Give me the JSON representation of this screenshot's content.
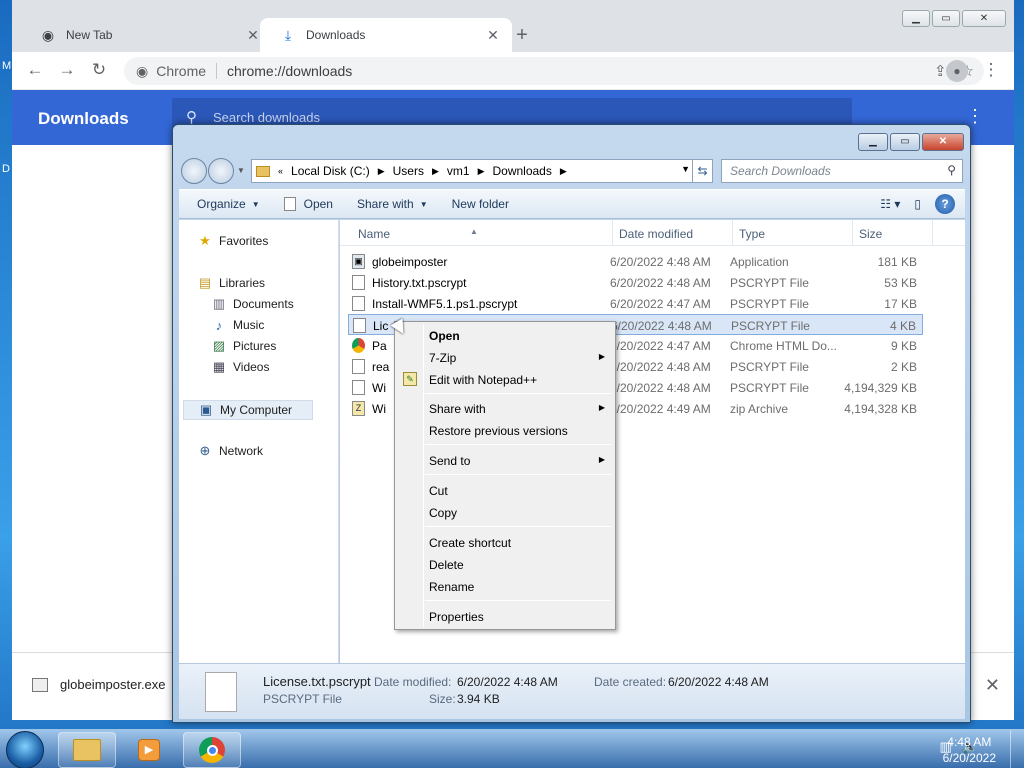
{
  "desktop": {
    "frag1": "M",
    "frag2": "D"
  },
  "chrome": {
    "tabs": [
      {
        "label": "New Tab",
        "icon": "chrome-icon"
      },
      {
        "label": "Downloads",
        "icon": "download-icon"
      }
    ],
    "new_tab_symbol": "+",
    "omnibox": {
      "label": "Chrome",
      "url": "chrome://downloads"
    },
    "downloads_page": {
      "title": "Downloads",
      "search_placeholder": "Search downloads",
      "shelf_item": "globeimposter.exe"
    }
  },
  "explorer": {
    "breadcrumbs": [
      "Local Disk (C:)",
      "Users",
      "vm1",
      "Downloads"
    ],
    "search_placeholder": "Search Downloads",
    "commands": {
      "organize": "Organize",
      "open": "Open",
      "share_with": "Share with",
      "new_folder": "New folder"
    },
    "nav": {
      "favorites": "Favorites",
      "libraries": "Libraries",
      "documents": "Documents",
      "music": "Music",
      "pictures": "Pictures",
      "videos": "Videos",
      "my_computer": "My Computer",
      "network": "Network"
    },
    "columns": {
      "name": "Name",
      "date": "Date modified",
      "type": "Type",
      "size": "Size"
    },
    "files": [
      {
        "name": "globeimposter",
        "date": "6/20/2022 4:48 AM",
        "type": "Application",
        "size": "181 KB"
      },
      {
        "name": "History.txt.pscrypt",
        "date": "6/20/2022 4:48 AM",
        "type": "PSCRYPT File",
        "size": "53 KB"
      },
      {
        "name": "Install-WMF5.1.ps1.pscrypt",
        "date": "6/20/2022 4:47 AM",
        "type": "PSCRYPT File",
        "size": "17 KB"
      },
      {
        "name": "Lic",
        "date": "6/20/2022 4:48 AM",
        "type": "PSCRYPT File",
        "size": "4 KB"
      },
      {
        "name": "Pa",
        "date": "6/20/2022 4:47 AM",
        "type": "Chrome HTML Do...",
        "size": "9 KB"
      },
      {
        "name": "rea",
        "date": "6/20/2022 4:48 AM",
        "type": "PSCRYPT File",
        "size": "2 KB"
      },
      {
        "name": "Wi",
        "date": "6/20/2022 4:48 AM",
        "type": "PSCRYPT File",
        "size": "4,194,329 KB"
      },
      {
        "name": "Wi",
        "date": "6/20/2022 4:49 AM",
        "type": "zip Archive",
        "size": "4,194,328 KB"
      }
    ],
    "details": {
      "filename": "License.txt.pscrypt",
      "filetype": "PSCRYPT File",
      "date_modified_label": "Date modified:",
      "date_modified": "6/20/2022 4:48 AM",
      "date_created_label": "Date created:",
      "date_created": "6/20/2022 4:48 AM",
      "size_label": "Size:",
      "size": "3.94 KB"
    }
  },
  "context_menu": {
    "open": "Open",
    "seven_zip": "7-Zip",
    "edit_notepad": "Edit with Notepad++",
    "share_with": "Share with",
    "restore": "Restore previous versions",
    "send_to": "Send to",
    "cut": "Cut",
    "copy": "Copy",
    "create_shortcut": "Create shortcut",
    "delete": "Delete",
    "rename": "Rename",
    "properties": "Properties"
  },
  "taskbar": {
    "time": "4:48 AM",
    "date": "6/20/2022"
  }
}
